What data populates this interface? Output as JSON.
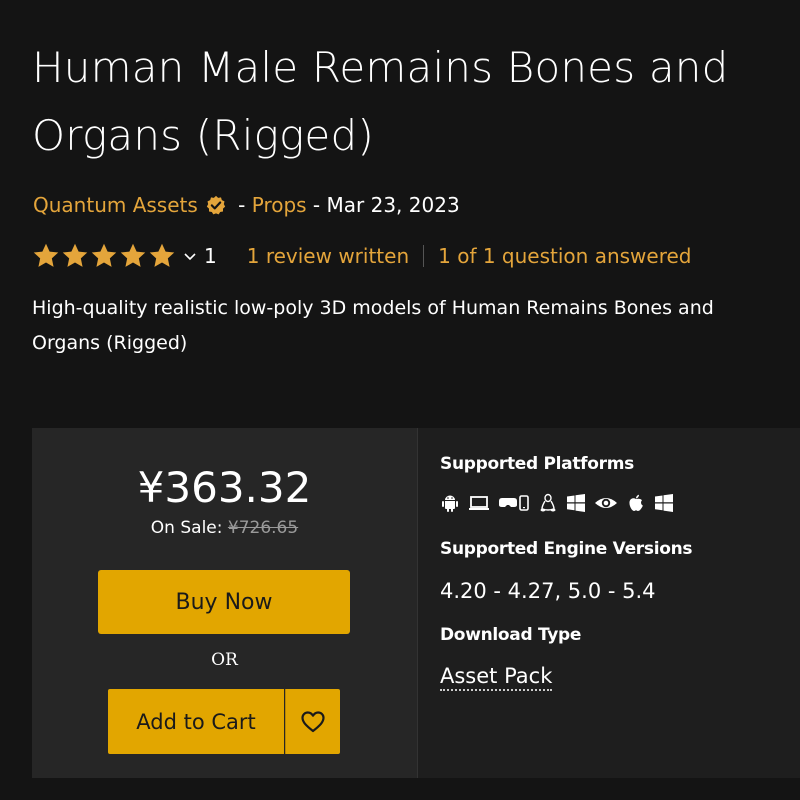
{
  "product": {
    "title": "Human Male Remains Bones and Organs (Rigged)",
    "seller": "Quantum Assets",
    "meta_sep_1": " - ",
    "category": "Props",
    "meta_sep_2": " - ",
    "date": "Mar 23, 2023",
    "description": "High-quality realistic low-poly 3D models of Human Remains Bones and Organs (Rigged)"
  },
  "rating": {
    "stars": 5,
    "max_stars": 5,
    "count": "1",
    "reviews_link": "1 review written",
    "questions_link": "1 of 1 question answered"
  },
  "purchase": {
    "price": "¥363.32",
    "on_sale_label": "On Sale:",
    "original_price": "¥726.65",
    "buy_now_label": "Buy Now",
    "or_label": "OR",
    "add_to_cart_label": "Add to Cart"
  },
  "details": {
    "platforms_heading": "Supported Platforms",
    "platform_icons": [
      "android-icon",
      "laptop-icon",
      "vr-headset-icon",
      "linux-icon",
      "windows-icon",
      "eye-icon",
      "apple-icon",
      "windows-icon"
    ],
    "engine_heading": "Supported Engine Versions",
    "engine_versions": "4.20 - 4.27, 5.0 - 5.4",
    "download_heading": "Download Type",
    "download_type": "Asset Pack"
  },
  "colors": {
    "accent": "#e4a53b",
    "button": "#e2a600",
    "background": "#141414",
    "panel": "#262626"
  }
}
